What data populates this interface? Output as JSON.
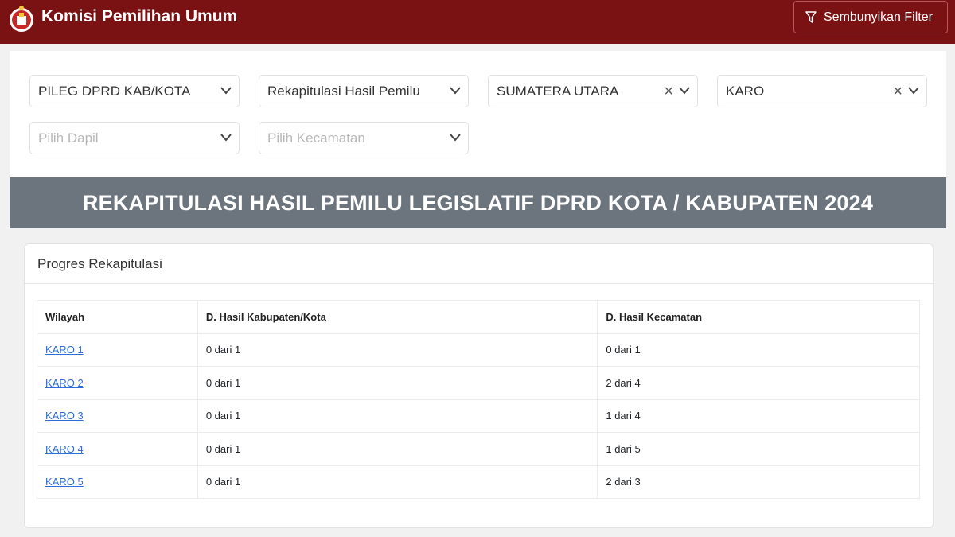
{
  "header": {
    "app_title": "Komisi Pemilihan Umum",
    "filter_button": "Sembunyikan Filter"
  },
  "filters": [
    {
      "value": "PILEG DPRD KAB/KOTA",
      "placeholder": false,
      "clearable": false
    },
    {
      "value": "Rekapitulasi Hasil Pemilu",
      "placeholder": false,
      "clearable": false
    },
    {
      "value": "SUMATERA UTARA",
      "placeholder": false,
      "clearable": true
    },
    {
      "value": "KARO",
      "placeholder": false,
      "clearable": true
    },
    {
      "value": "Pilih Dapil",
      "placeholder": true,
      "clearable": false
    },
    {
      "value": "Pilih Kecamatan",
      "placeholder": true,
      "clearable": false
    }
  ],
  "banner": {
    "title": "REKAPITULASI HASIL PEMILU LEGISLATIF DPRD KOTA / KABUPATEN 2024"
  },
  "progress": {
    "title": "Progres Rekapitulasi",
    "columns": [
      "Wilayah",
      "D. Hasil Kabupaten/Kota",
      "D. Hasil Kecamatan"
    ],
    "rows": [
      {
        "wilayah": "KARO 1",
        "kab": "0 dari 1",
        "kec": "0 dari 1"
      },
      {
        "wilayah": "KARO 2",
        "kab": "0 dari 1",
        "kec": "2 dari 4"
      },
      {
        "wilayah": "KARO 3",
        "kab": "0 dari 1",
        "kec": "1 dari 4"
      },
      {
        "wilayah": "KARO 4",
        "kab": "0 dari 1",
        "kec": "1 dari 5"
      },
      {
        "wilayah": "KARO 5",
        "kab": "0 dari 1",
        "kec": "2 dari 3"
      }
    ]
  },
  "colors": {
    "header_bg": "#7a1214",
    "banner_bg": "#6c757d",
    "link": "#2f6ed8"
  },
  "icons": {
    "logo": "kpu-logo",
    "filter": "funnel-icon",
    "dropdown": "chevron-down-icon",
    "clear": "clear-x-icon"
  }
}
